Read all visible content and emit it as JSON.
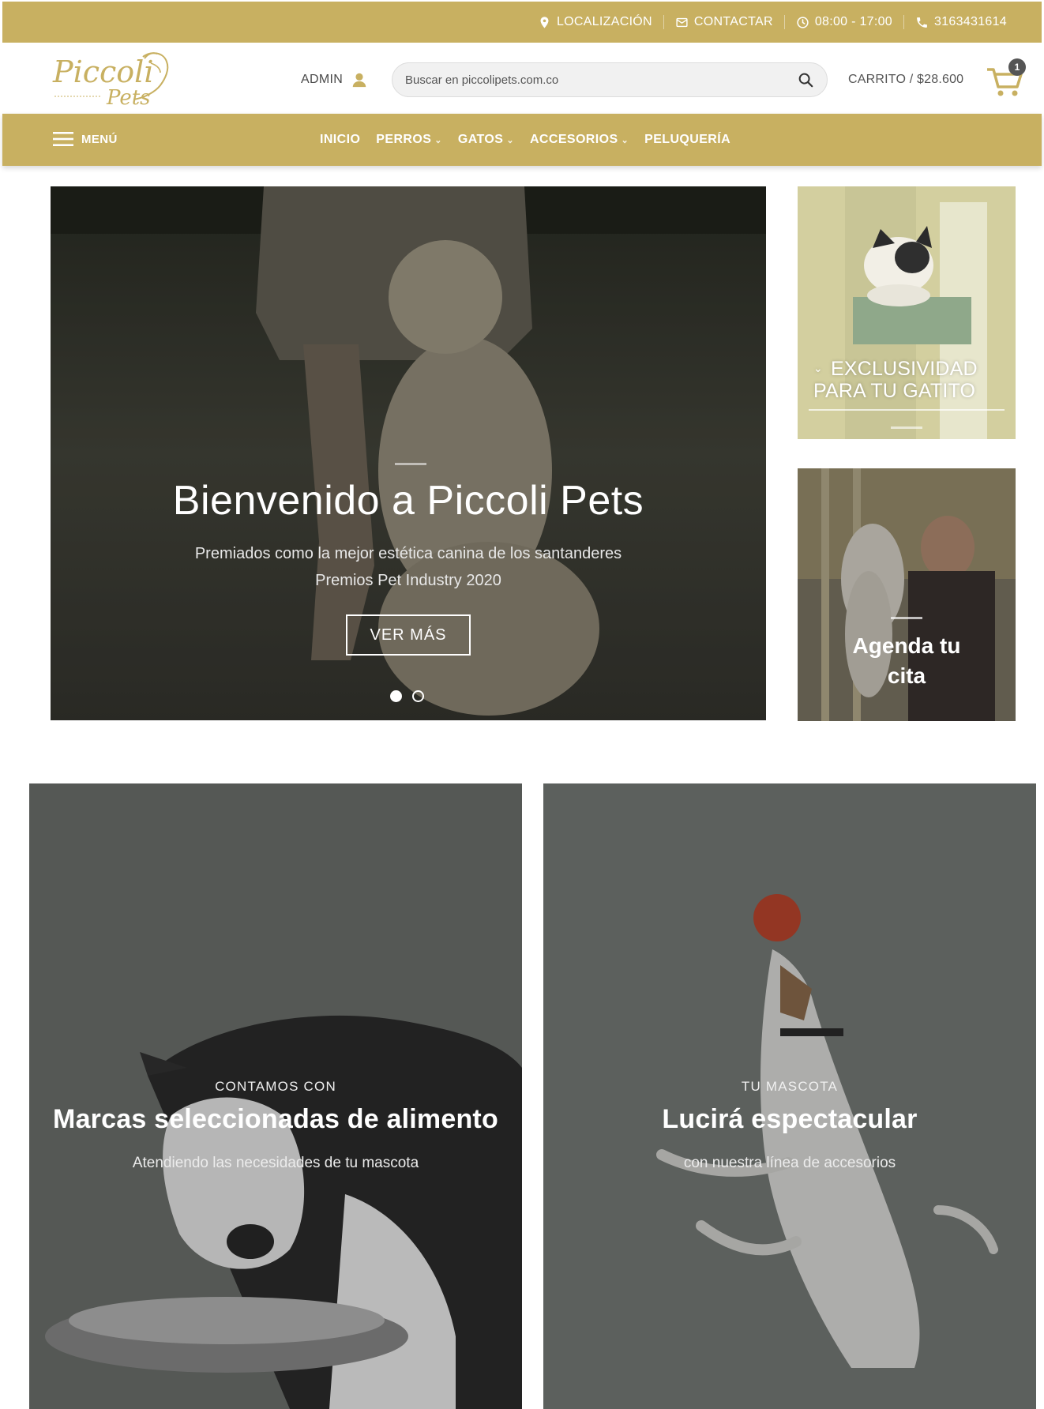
{
  "colors": {
    "brand_gold": "#c8b061",
    "text_dark": "#4a4a4a",
    "white": "#ffffff"
  },
  "topbar": {
    "location_label": "LOCALIZACIÓN",
    "contact_label": "CONTACTAR",
    "hours_label": "08:00 - 17:00",
    "phone_label": "3163431614"
  },
  "header": {
    "logo_alt": "Piccoli Pets",
    "admin_label": "ADMIN",
    "search_placeholder": "Buscar en piccolipets.com.co",
    "cart_label": "CARRITO / $28.600",
    "cart_count": "1"
  },
  "nav": {
    "menu_label": "MENÚ",
    "items": [
      {
        "label": "INICIO",
        "has_dropdown": false
      },
      {
        "label": "PERROS",
        "has_dropdown": true
      },
      {
        "label": "GATOS",
        "has_dropdown": true
      },
      {
        "label": "ACCESORIOS",
        "has_dropdown": true
      },
      {
        "label": "PELUQUERÍA",
        "has_dropdown": false
      }
    ]
  },
  "hero": {
    "title": "Bienvenido a Piccoli Pets",
    "subtitle_line1": "Premiados como la mejor estética canina de los santanderes",
    "subtitle_line2": "Premios Pet Industry 2020",
    "button_label": "VER MÁS",
    "slide_count": 2,
    "active_slide": 1
  },
  "promos": {
    "cat": {
      "line1": "EXCLUSIVIDAD",
      "line2": "PARA TU GATITO"
    },
    "grooming": {
      "line1": "Agenda tu",
      "line2": "cita"
    }
  },
  "banners": [
    {
      "kicker": "CONTAMOS CON",
      "title": "Marcas seleccionadas de alimento",
      "subtitle": "Atendiendo las necesidades de tu mascota"
    },
    {
      "kicker": "TU MASCOTA",
      "title": "Lucirá espectacular",
      "subtitle": "con nuestra línea de accesorios"
    }
  ]
}
